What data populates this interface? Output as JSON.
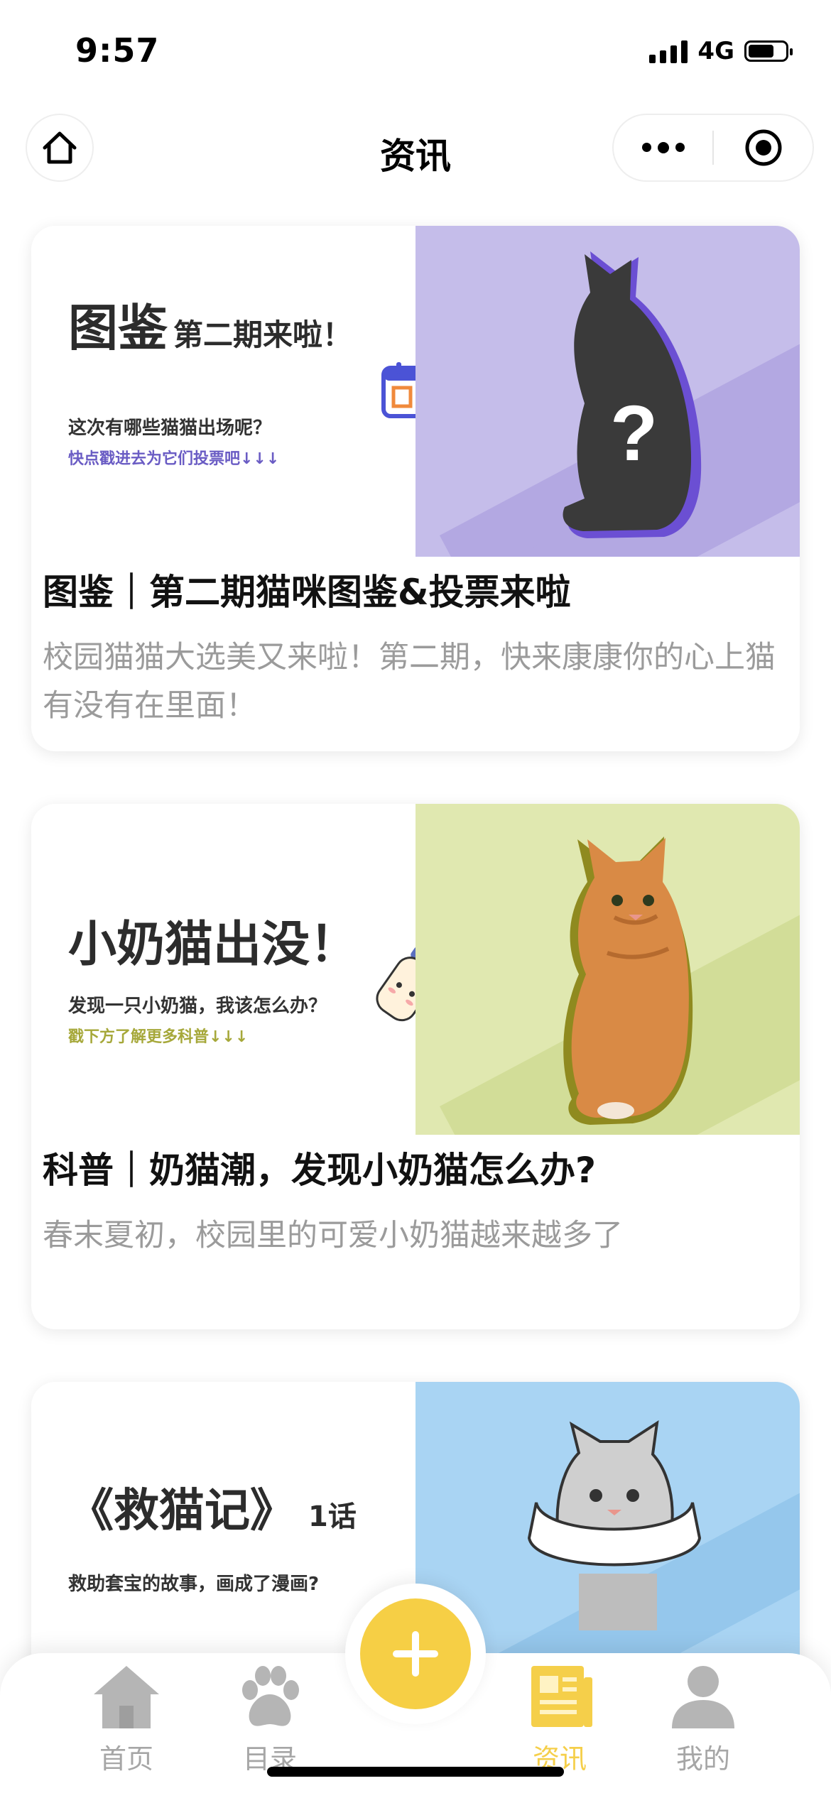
{
  "status_bar": {
    "time": "9:57",
    "network": "4G",
    "battery_level": 0.7
  },
  "nav": {
    "title": "资讯"
  },
  "articles": [
    {
      "banner": {
        "title_big": "图鉴",
        "title_small": "第二期来啦！",
        "subtitle": "这次有哪些猫猫出场呢？",
        "link": "快点戳进去为它们投票吧↓↓↓",
        "overlay": "?",
        "bg_color": "#c5bdea",
        "link_color": "#6a5cc4"
      },
      "title": "图鉴｜第二期猫咪图鉴&投票来啦",
      "desc": "校园猫猫大选美又来啦！第二期，快来康康你的心上猫有没有在里面！"
    },
    {
      "banner": {
        "title_big": "小奶猫出没！",
        "subtitle": "发现一只小奶猫，我该怎么办？",
        "link": "戳下方了解更多科普↓↓↓",
        "bg_color": "#e0e8b0",
        "link_color": "#a6a83a"
      },
      "title": "科普｜奶猫潮，发现小奶猫怎么办?",
      "desc": "春末夏初，校园里的可爱小奶猫越来越多了"
    },
    {
      "banner": {
        "title_big": "《救猫记》",
        "title_small": "1话",
        "subtitle": "救助套宝的故事，画成了漫画?",
        "bg_color": "#a9d4f3"
      },
      "title": "",
      "desc": ""
    }
  ],
  "tabbar": {
    "items": [
      {
        "label": "首页",
        "icon": "house-icon"
      },
      {
        "label": "目录",
        "icon": "paw-icon"
      },
      {
        "label": "资讯",
        "icon": "newspaper-icon",
        "active": true
      },
      {
        "label": "我的",
        "icon": "person-icon"
      }
    ],
    "add_icon": "plus-icon",
    "active_color": "#f5cf4a"
  }
}
